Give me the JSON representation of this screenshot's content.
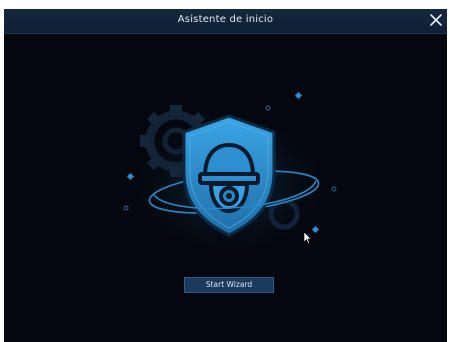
{
  "dialog": {
    "title": "Asistente de inicio",
    "close_icon": "close-icon"
  },
  "hero": {
    "illustration": "security-camera-shield-illustration",
    "icons": [
      "shield-icon",
      "dome-camera-icon",
      "gear-icon",
      "orbit-ring-icon"
    ]
  },
  "actions": {
    "start_label": "Start Wizard"
  },
  "colors": {
    "background": "#04070d",
    "titlebar": "#10233a",
    "accent": "#2e8fd0",
    "button": "#1b3a5e"
  }
}
